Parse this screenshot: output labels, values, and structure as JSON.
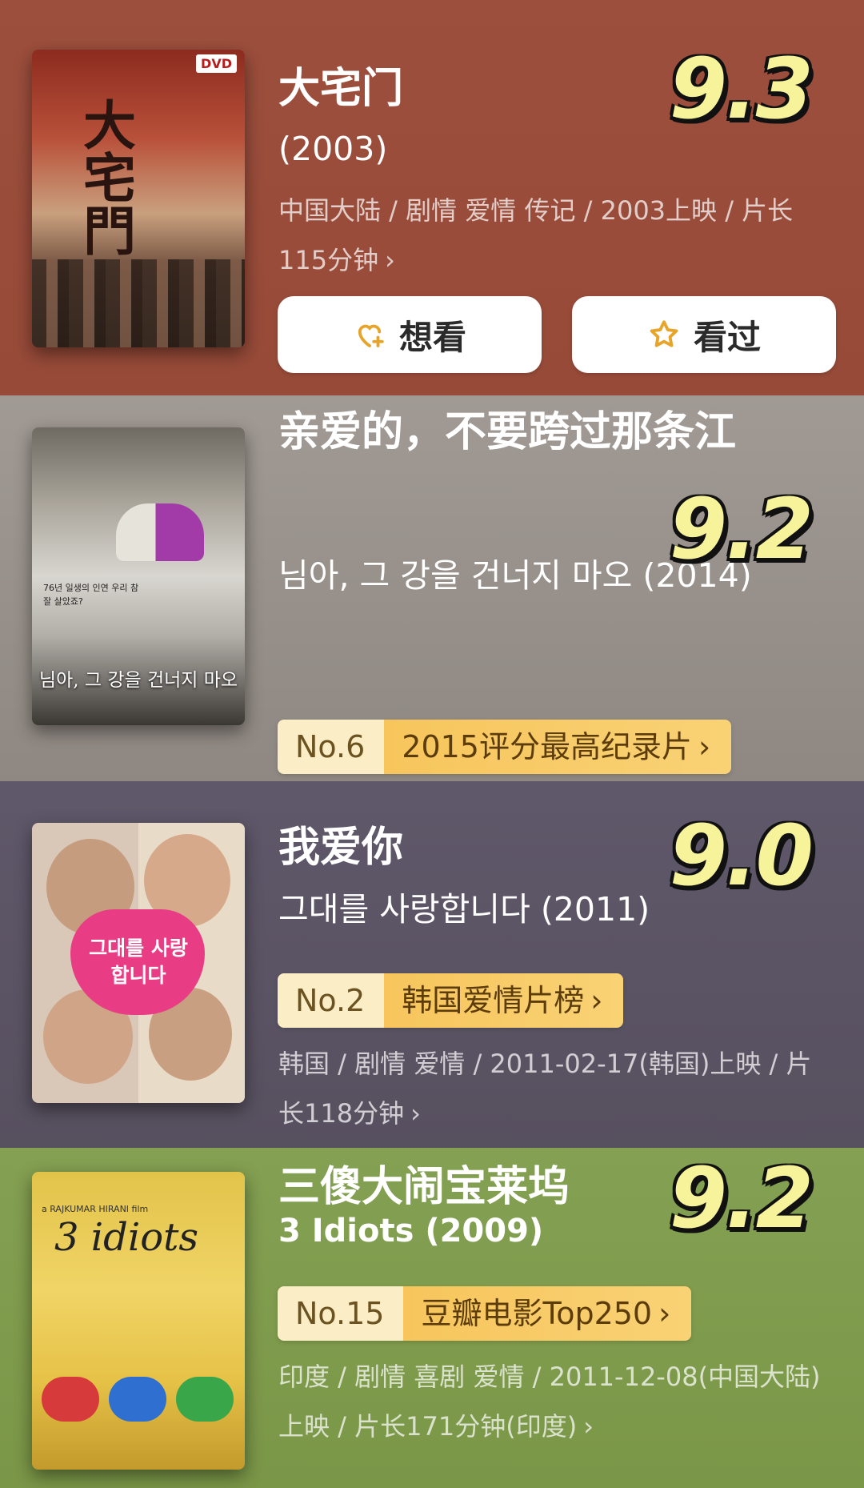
{
  "movies": [
    {
      "title": "大宅门",
      "subtitle": "(2003)",
      "meta": "中国大陆 / 剧情 爱情 传记 / 2003上映 / 片长115分钟",
      "score": "9.3",
      "poster_text": "大宅門",
      "poster_badge": "DVD",
      "bg": "#9a4c3a",
      "actions": {
        "want_label": "想看",
        "seen_label": "看过"
      }
    },
    {
      "title": "亲爱的，不要跨过那条江",
      "subtitle": "님아, 그 강을 건너지 마오 (2014)",
      "score": "9.2",
      "poster_text": "님아, 그 강을 건너지 마오",
      "poster_caption": "76년 일생의 인연 우리 참 잘 살았죠?",
      "rank_no": "No.6",
      "rank_list": "2015评分最高纪录片",
      "bg": "#9e9690"
    },
    {
      "title": "我爱你",
      "subtitle": "그대를 사랑합니다 (2011)",
      "meta": "韩国 / 剧情 爱情 / 2011-02-17(韩国)上映 / 片长118分钟",
      "score": "9.0",
      "poster_text": "그대를 사랑합니다",
      "rank_no": "No.2",
      "rank_list": "韩国爱情片榜",
      "bg": "#5a5365"
    },
    {
      "title": "三傻大闹宝莱坞",
      "subtitle": "3 Idiots (2009)",
      "meta": "印度 / 剧情 喜剧 爱情 / 2011-12-08(中国大陆)上映 / 片长171分钟(印度)",
      "score": "9.2",
      "poster_text": "3 idiots",
      "poster_credit": "a RAJKUMAR HIRANI film",
      "rank_no": "No.15",
      "rank_list": "豆瓣电影Top250",
      "bg": "#7f9b4c"
    }
  ],
  "chevron": "›"
}
